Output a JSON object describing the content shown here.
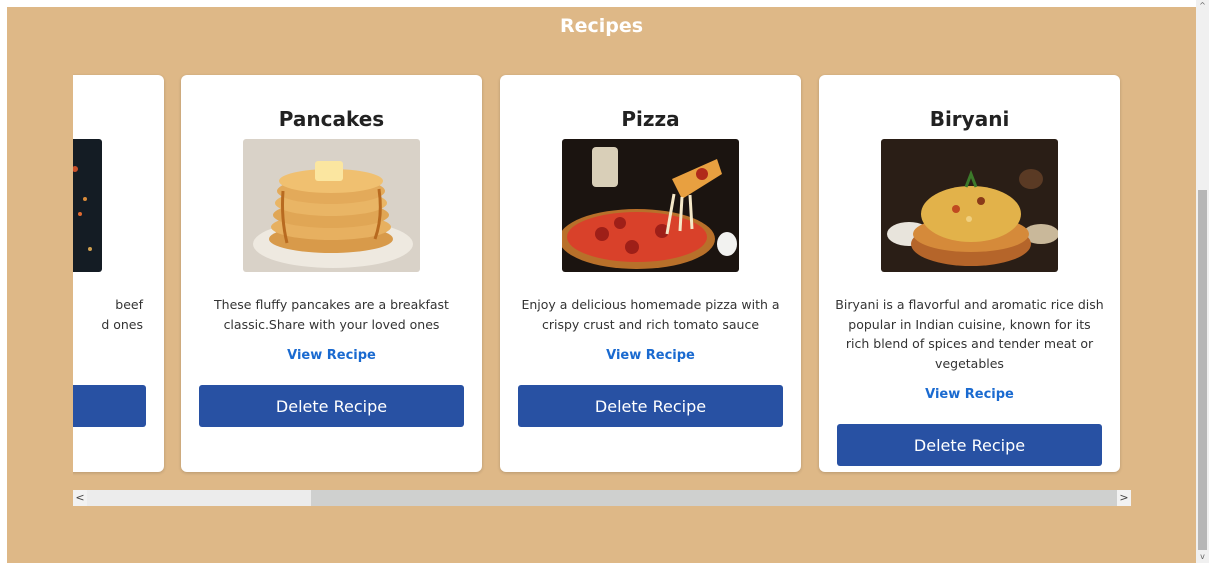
{
  "page": {
    "title": "Recipes"
  },
  "recipes": [
    {
      "name": "",
      "desc_lines": [
        "beef",
        "d ones"
      ],
      "view_label": "",
      "delete_label": ""
    },
    {
      "name": "Pancakes",
      "desc_lines": [
        "These fluffy pancakes are a breakfast",
        "classic.Share with your loved ones"
      ],
      "view_label": "View Recipe",
      "delete_label": "Delete Recipe"
    },
    {
      "name": "Pizza",
      "desc_lines": [
        "Enjoy a delicious homemade pizza with a",
        "crispy crust and rich tomato sauce"
      ],
      "view_label": "View Recipe",
      "delete_label": "Delete Recipe"
    },
    {
      "name": "Biryani",
      "desc_lines": [
        "Biryani is a flavorful and aromatic rice dish",
        "popular in Indian cuisine, known for its",
        "rich blend of spices and tender meat or",
        "vegetables"
      ],
      "view_label": "View Recipe",
      "delete_label": "Delete Recipe"
    }
  ],
  "scrollbar": {
    "left_arrow": "<",
    "right_arrow": ">",
    "up_arrow": "^",
    "down_arrow": "v"
  },
  "colors": {
    "background": "#deb887",
    "card": "#ffffff",
    "button": "#2851a3",
    "link": "#1a6ad0"
  }
}
